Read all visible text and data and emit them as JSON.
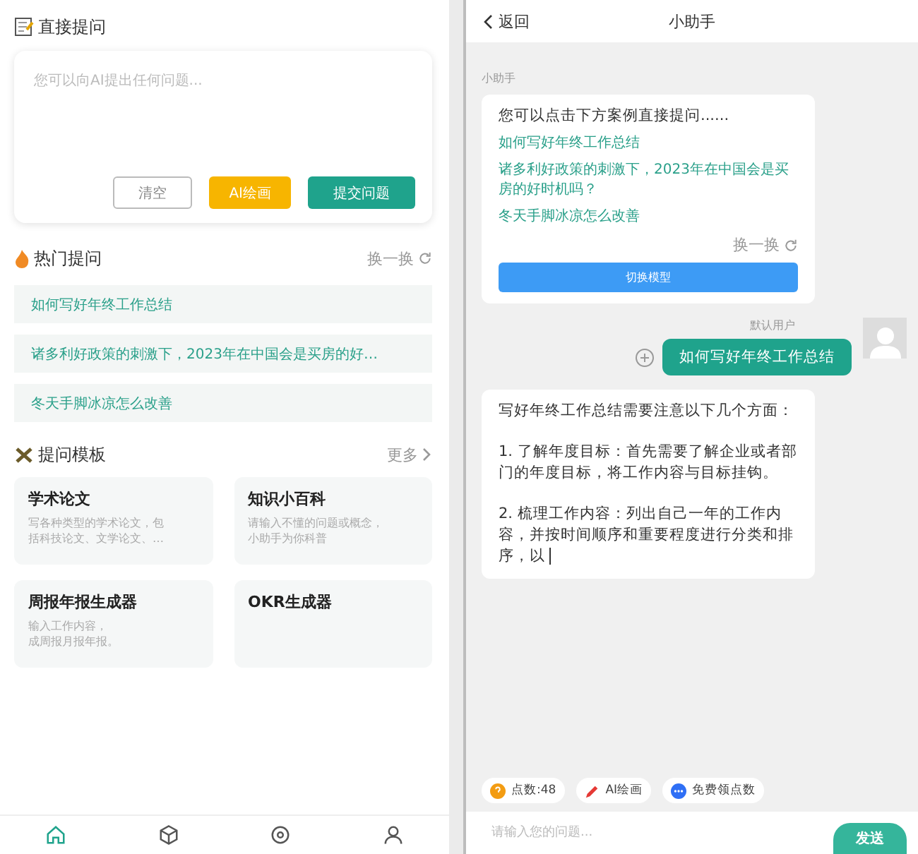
{
  "ask": {
    "title": "直接提问",
    "placeholder": "您可以向AI提出任何问题...",
    "buttons": [
      {
        "kind": "outline",
        "label": "清空"
      },
      {
        "kind": "warning",
        "label": "AI绘画"
      },
      {
        "kind": "primary",
        "label": "提交问题"
      }
    ]
  },
  "hot": {
    "title": "热门提问",
    "refresh": "换一换",
    "items": [
      "如何写好年终工作总结",
      "诸多利好政策的刺激下，2023年在中国会是买房的好…",
      "冬天手脚冰凉怎么改善"
    ]
  },
  "templates": {
    "title": "提问模板",
    "more": "更多",
    "cards": [
      {
        "title": "学术论文",
        "desc": [
          "写各种类型的学术论文，包",
          "括科技论文、文学论文、…"
        ]
      },
      {
        "title": "知识小百科",
        "desc": [
          "请输入不懂的问题或概念，",
          "小助手为你科普"
        ]
      },
      {
        "title": "周报年报生成器",
        "desc": [
          "输入工作内容，",
          "成周报月报年报。"
        ]
      },
      {
        "title": "OKR生成器"
      }
    ]
  },
  "nav": [
    {
      "selected": true
    },
    {
      "selected": false
    },
    {
      "selected": false
    },
    {
      "selected": false
    }
  ],
  "chat": {
    "back": "返回",
    "title": "小助手",
    "bot_name": "小助手",
    "intro": "您可以点击下方案例直接提问......",
    "examples": [
      "如何写好年终工作总结",
      "诸多利好政策的刺激下，2023年在中国会是买房的好时机吗？",
      "冬天手脚冰凉怎么改善"
    ],
    "refresh": "换一换",
    "switch_model": "切换模型",
    "user_name": "默认用户",
    "user_message": "如何写好年终工作总结",
    "answer": [
      "写好年终工作总结需要注意以下几个方面：",
      "1. 了解年度目标：首先需要了解企业或者部门的年度目标，将工作内容与目标挂钩。",
      "2. 梳理工作内容：列出自己一年的工作内容，并按时间顺序和重要程度进行分类和排序，以"
    ],
    "chips": [
      {
        "label": "点数:48"
      },
      {
        "label": "AI绘画"
      },
      {
        "label": "免费领点数"
      }
    ],
    "input_placeholder": "请输入您的问题...",
    "send": "发送"
  }
}
